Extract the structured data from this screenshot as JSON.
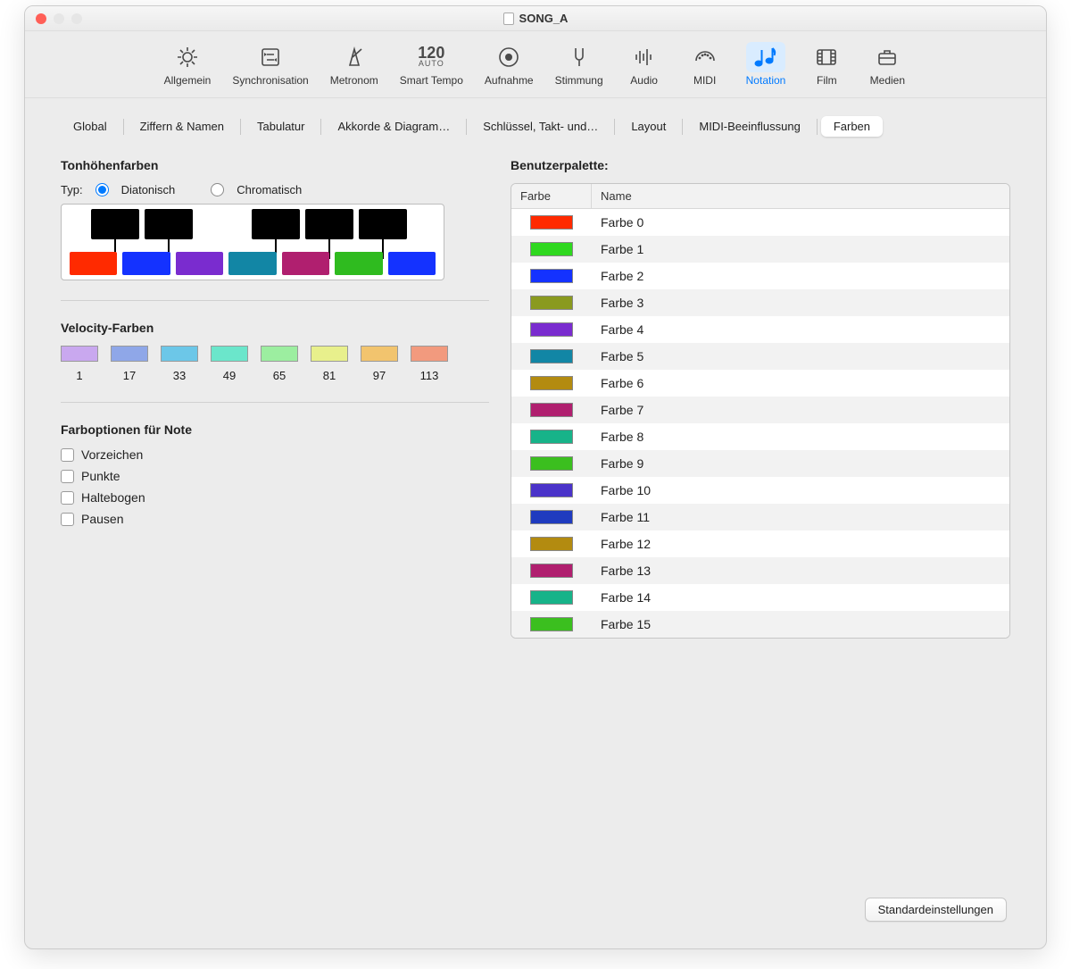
{
  "window": {
    "title": "SONG_A"
  },
  "toolbar": {
    "items": [
      {
        "id": "allgemein",
        "label": "Allgemein"
      },
      {
        "id": "synchronisation",
        "label": "Synchronisation"
      },
      {
        "id": "metronom",
        "label": "Metronom"
      },
      {
        "id": "smart-tempo",
        "label": "Smart Tempo",
        "tempo": "120",
        "auto": "AUTO"
      },
      {
        "id": "aufnahme",
        "label": "Aufnahme"
      },
      {
        "id": "stimmung",
        "label": "Stimmung"
      },
      {
        "id": "audio",
        "label": "Audio"
      },
      {
        "id": "midi",
        "label": "MIDI"
      },
      {
        "id": "notation",
        "label": "Notation",
        "selected": true
      },
      {
        "id": "film",
        "label": "Film"
      },
      {
        "id": "medien",
        "label": "Medien"
      }
    ]
  },
  "subtabs": [
    {
      "label": "Global"
    },
    {
      "label": "Ziffern & Namen"
    },
    {
      "label": "Tabulatur"
    },
    {
      "label": "Akkorde & Diagram…"
    },
    {
      "label": "Schlüssel, Takt- und…"
    },
    {
      "label": "Layout"
    },
    {
      "label": "MIDI-Beeinflussung"
    },
    {
      "label": "Farben",
      "selected": true
    }
  ],
  "left": {
    "pitch_heading": "Tonhöhenfarben",
    "type_label": "Typ:",
    "type_options": {
      "diatonisch": "Diatonisch",
      "chromatisch": "Chromatisch"
    },
    "type_selected": "diatonisch",
    "white_keys": [
      "#ff2a00",
      "#1432ff",
      "#7a2ccf",
      "#1286a5",
      "#b01f6f",
      "#2fbb1f",
      "#1432ff"
    ],
    "velocity_heading": "Velocity-Farben",
    "velocity": [
      {
        "n": "1",
        "c": "#c9a8ef"
      },
      {
        "n": "17",
        "c": "#8fa7e8"
      },
      {
        "n": "33",
        "c": "#6cc7e8"
      },
      {
        "n": "49",
        "c": "#6be6cb"
      },
      {
        "n": "65",
        "c": "#9ceea0"
      },
      {
        "n": "81",
        "c": "#e8f08c"
      },
      {
        "n": "97",
        "c": "#f2c46e"
      },
      {
        "n": "113",
        "c": "#f29a7e"
      }
    ],
    "noteopts_heading": "Farboptionen für Note",
    "noteopts": [
      "Vorzeichen",
      "Punkte",
      "Haltebogen",
      "Pausen"
    ]
  },
  "right": {
    "heading": "Benutzerpalette:",
    "columns": {
      "color": "Farbe",
      "name": "Name"
    },
    "rows": [
      {
        "name": "Farbe 0",
        "c": "#ff2a00"
      },
      {
        "name": "Farbe 1",
        "c": "#2fd81f"
      },
      {
        "name": "Farbe 2",
        "c": "#1432ff"
      },
      {
        "name": "Farbe 3",
        "c": "#8a9a1f"
      },
      {
        "name": "Farbe 4",
        "c": "#7a2ccf"
      },
      {
        "name": "Farbe 5",
        "c": "#1286a5"
      },
      {
        "name": "Farbe 6",
        "c": "#b38b10"
      },
      {
        "name": "Farbe 7",
        "c": "#b01f6f"
      },
      {
        "name": "Farbe 8",
        "c": "#17b389"
      },
      {
        "name": "Farbe 9",
        "c": "#3bbf1f"
      },
      {
        "name": "Farbe 10",
        "c": "#4a33c9"
      },
      {
        "name": "Farbe 11",
        "c": "#1f3bbf"
      },
      {
        "name": "Farbe 12",
        "c": "#b38b10"
      },
      {
        "name": "Farbe 13",
        "c": "#b01f6f"
      },
      {
        "name": "Farbe 14",
        "c": "#17b389"
      },
      {
        "name": "Farbe 15",
        "c": "#3bbf1f"
      }
    ]
  },
  "footer": {
    "defaults": "Standardeinstellungen"
  }
}
